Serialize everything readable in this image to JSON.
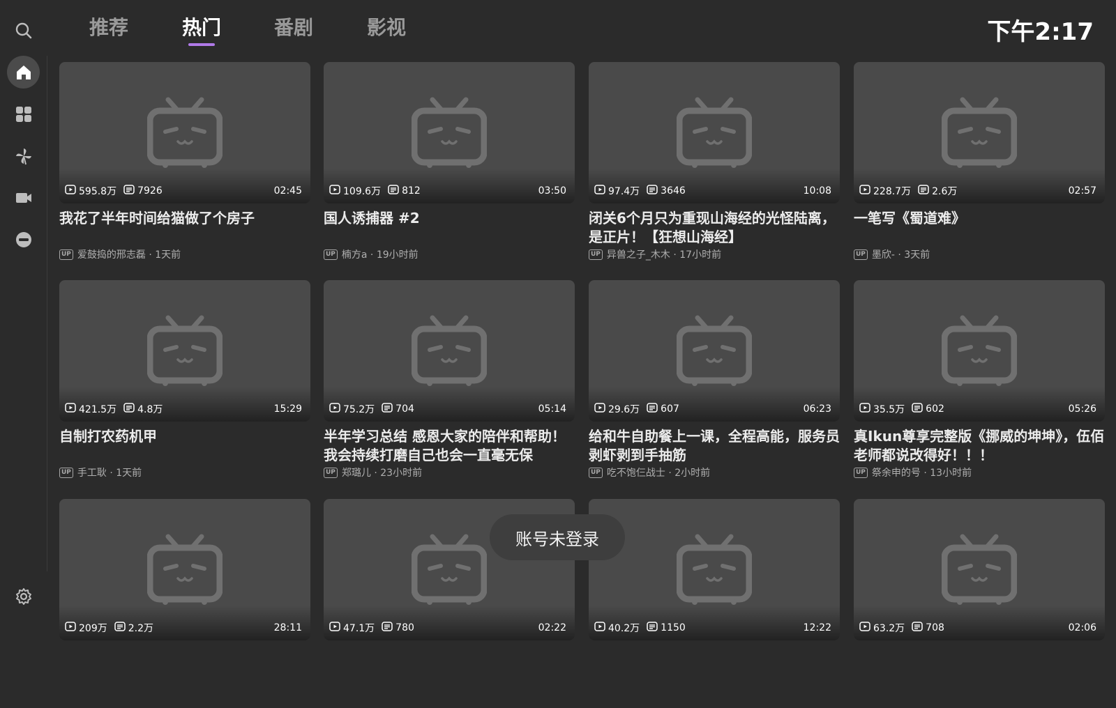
{
  "tabs": [
    {
      "label": "推荐"
    },
    {
      "label": "热门"
    },
    {
      "label": "番剧"
    },
    {
      "label": "影视"
    }
  ],
  "active_tab": "热门",
  "clock": "下午2:17",
  "sidebar": [
    "search-icon",
    "home-icon",
    "categories-icon",
    "pinwheel-icon",
    "video-camera-icon",
    "bangumi-icon",
    "settings-icon"
  ],
  "up_badge": "UP",
  "toast": "账号未登录",
  "videos": [
    {
      "views": "595.8万",
      "danmaku": "7926",
      "duration": "02:45",
      "title": "我花了半年时间给猫做了个房子",
      "uploader": "爱鼓捣的邢志磊 · 1天前"
    },
    {
      "views": "109.6万",
      "danmaku": "812",
      "duration": "03:50",
      "title": "国人诱捕器 #2",
      "uploader": "楠方a · 19小时前"
    },
    {
      "views": "97.4万",
      "danmaku": "3646",
      "duration": "10:08",
      "title": "闭关6个月只为重现山海经的光怪陆离，是正片！【狂想山海经】",
      "uploader": "异兽之子_木木 · 17小时前"
    },
    {
      "views": "228.7万",
      "danmaku": "2.6万",
      "duration": "02:57",
      "title": "一笔写《蜀道难》",
      "uploader": "墨欣- · 3天前"
    },
    {
      "views": "421.5万",
      "danmaku": "4.8万",
      "duration": "15:29",
      "title": "自制打农药机甲",
      "uploader": "手工耿 · 1天前"
    },
    {
      "views": "75.2万",
      "danmaku": "704",
      "duration": "05:14",
      "title": "半年学习总结 感恩大家的陪伴和帮助！我会持续打磨自己也会一直毫无保",
      "uploader": "郑璐儿 · 23小时前"
    },
    {
      "views": "29.6万",
      "danmaku": "607",
      "duration": "06:23",
      "title": "给和牛自助餐上一课，全程高能，服务员剥虾剥到手抽筋",
      "uploader": "吃不饱仨战士 · 2小时前"
    },
    {
      "views": "35.5万",
      "danmaku": "602",
      "duration": "05:26",
      "title": "真Ikun尊享完整版《挪威的坤坤》，伍佰老师都说改得好！！！",
      "uploader": "祭余申的号 · 13小时前"
    },
    {
      "views": "209万",
      "danmaku": "2.2万",
      "duration": "28:11",
      "title": "",
      "uploader": ""
    },
    {
      "views": "47.1万",
      "danmaku": "780",
      "duration": "02:22",
      "title": "",
      "uploader": ""
    },
    {
      "views": "40.2万",
      "danmaku": "1150",
      "duration": "12:22",
      "title": "",
      "uploader": ""
    },
    {
      "views": "63.2万",
      "danmaku": "708",
      "duration": "02:06",
      "title": "",
      "uploader": ""
    }
  ]
}
